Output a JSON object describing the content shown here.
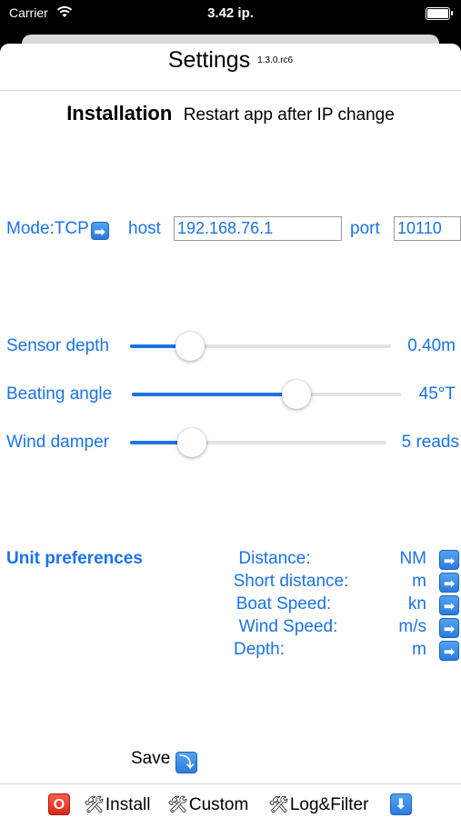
{
  "status_bar": {
    "carrier": "Carrier",
    "time": "3.42 ip."
  },
  "nav": {
    "title": "Settings",
    "version": "1.3.0.rc6"
  },
  "installation": {
    "heading": "Installation",
    "note": "Restart app after IP change"
  },
  "connection": {
    "mode_label": "Mode:TCP",
    "host_label": "host",
    "host_value": "192.168.76.1",
    "port_label": "port",
    "port_value": "10110"
  },
  "sliders": [
    {
      "label": "Sensor depth",
      "value_text": "0.40m",
      "fraction": 0.23
    },
    {
      "label": "Beating angle",
      "value_text": "45°T",
      "fraction": 0.61
    },
    {
      "label": "Wind damper",
      "value_text": "5 reads",
      "fraction": 0.24
    }
  ],
  "units": {
    "title": "Unit preferences",
    "rows": [
      {
        "label": "Distance:",
        "value": "NM"
      },
      {
        "label": "Short distance:",
        "value": "m"
      },
      {
        "label": "Boat Speed:",
        "value": "kn"
      },
      {
        "label": "Wind Speed:",
        "value": "m/s"
      },
      {
        "label": "Depth:",
        "value": "m"
      }
    ]
  },
  "save": {
    "label": "Save"
  },
  "toolbar": {
    "stop_glyph": "O",
    "install_label": "Install",
    "custom_label": "Custom",
    "logfilter_label": "Log&Filter"
  },
  "icons": {
    "arrow_right": "➡",
    "save": "⤵",
    "download": "⬇",
    "tools": "🛠"
  },
  "colors": {
    "accent": "#1a73e8",
    "stop": "#e03a2b"
  }
}
